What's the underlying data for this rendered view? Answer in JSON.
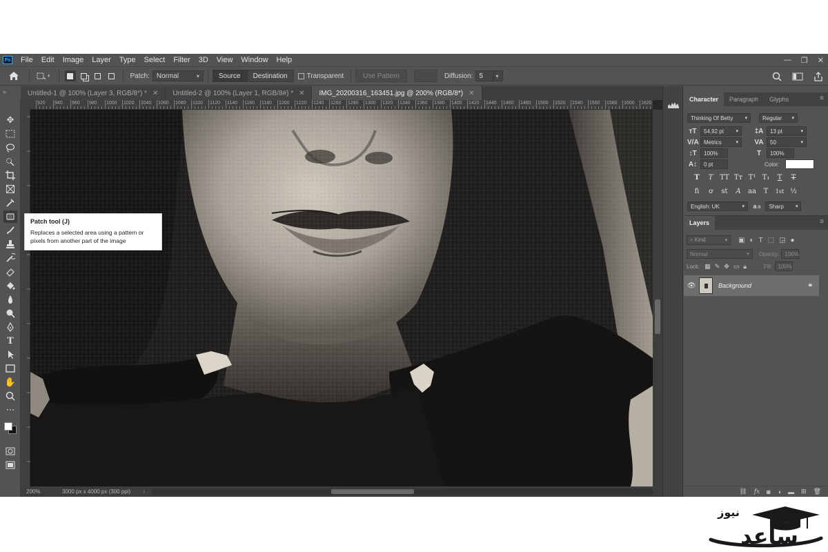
{
  "app": {
    "logo": "Ps",
    "menu": [
      "File",
      "Edit",
      "Image",
      "Layer",
      "Type",
      "Select",
      "Filter",
      "3D",
      "View",
      "Window",
      "Help"
    ]
  },
  "options_bar": {
    "patch_label": "Patch:",
    "patch_mode": "Normal",
    "source_label": "Source",
    "destination_label": "Destination",
    "transparent_label": "Transparent",
    "use_pattern_label": "Use Pattern",
    "diffusion_label": "Diffusion:",
    "diffusion_value": "5"
  },
  "tabs": [
    {
      "label": "Untitled-1 @ 100% (Layer 3, RGB/8*) *",
      "active": false
    },
    {
      "label": "Untitled-2 @ 100% (Layer 1, RGB/8#) *",
      "active": false
    },
    {
      "label": "IMG_20200316_163451.jpg @ 200% (RGB/8*)",
      "active": true
    }
  ],
  "ruler": {
    "ticks": [
      "920",
      "940",
      "960",
      "980",
      "1000",
      "1020",
      "1040",
      "1060",
      "1080",
      "1100",
      "1120",
      "1140",
      "1160",
      "1180",
      "1200",
      "1220",
      "1240",
      "1260",
      "1280",
      "1300",
      "1320",
      "1340",
      "1360",
      "1380",
      "1400",
      "1420",
      "1440",
      "1460",
      "1480",
      "1500",
      "1520",
      "1540",
      "1560",
      "1580",
      "1600",
      "1620"
    ]
  },
  "tooltip": {
    "title": "Patch tool (J)",
    "description": "Replaces a selected area using a pattern or pixels from another part of the image"
  },
  "status": {
    "zoom": "200%",
    "doc_info": "3000 px x 4000 px (300 ppi)"
  },
  "character_panel": {
    "tabs": [
      "Character",
      "Paragraph",
      "Glyphs"
    ],
    "font_family": "Thinking Of Betty",
    "font_style": "Regular",
    "font_size": "54,92 pt",
    "leading": "13 pt",
    "kerning": "Metrics",
    "tracking": "50",
    "vertical_scale": "100%",
    "horizontal_scale": "100%",
    "baseline_shift": "0 pt",
    "color_label": "Color:",
    "language": "English: UK",
    "antialias": "Sharp",
    "aa_label": "a",
    "text_style_buttons": [
      "T",
      "T",
      "TT",
      "Tт",
      "T¹",
      "T₁",
      "T",
      "T"
    ],
    "opentype_buttons": [
      "fi",
      "ơ",
      "st",
      "A",
      "aa",
      "T",
      "1st",
      "½"
    ]
  },
  "layers_panel": {
    "title": "Layers",
    "kind_label": "Kind",
    "blend_mode": "Normal",
    "opacity_label": "Opacity:",
    "opacity_value": "100%",
    "lock_label": "Lock:",
    "fill_label": "Fill:",
    "fill_value": "100%",
    "layer_name": "Background",
    "footer_icons": [
      "link-icon",
      "fx-icon",
      "mask-icon",
      "adjustment-icon",
      "group-icon",
      "new-layer-icon",
      "trash-icon"
    ]
  },
  "colors": {
    "ui_bg": "#535353",
    "panel_header": "#424242",
    "canvas_bg": "#282828",
    "accent_ps": "#31a8ff"
  },
  "watermark": {
    "text": "ساعد",
    "subtext": "نیوز"
  }
}
